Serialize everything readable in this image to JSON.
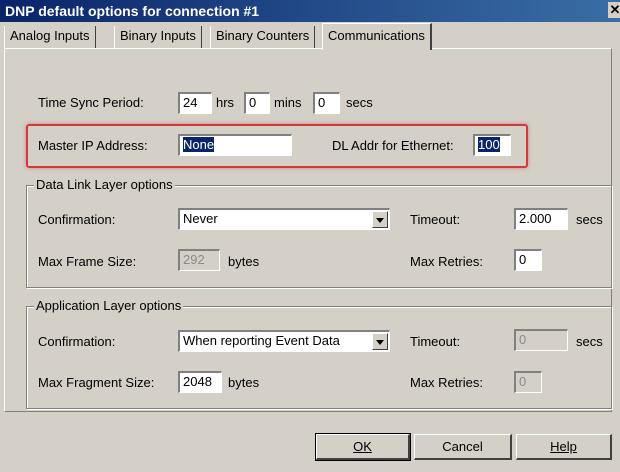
{
  "window": {
    "title": "DNP default options for connection #1",
    "close_glyph": "✕"
  },
  "tabs": [
    {
      "label": "Analog Inputs"
    },
    {
      "label": "Binary Inputs"
    },
    {
      "label": "Binary Counters"
    },
    {
      "label": "Communications",
      "active": true
    }
  ],
  "time_sync": {
    "label": "Time Sync Period:",
    "hrs_value": "24",
    "hrs_unit": "hrs",
    "mins_value": "0",
    "mins_unit": "mins",
    "secs_value": "0",
    "secs_unit": "secs"
  },
  "master": {
    "ip_label": "Master IP Address:",
    "ip_value": "None",
    "dl_label": "DL Addr for Ethernet:",
    "dl_value": "100"
  },
  "data_link": {
    "legend": "Data Link Layer options",
    "confirmation_label": "Confirmation:",
    "confirmation_value": "Never",
    "timeout_label": "Timeout:",
    "timeout_value": "2.000",
    "timeout_unit": "secs",
    "frame_label": "Max Frame Size:",
    "frame_value": "292",
    "frame_unit": "bytes",
    "retries_label": "Max Retries:",
    "retries_value": "0"
  },
  "application": {
    "legend": "Application Layer options",
    "confirmation_label": "Confirmation:",
    "confirmation_value": "When reporting Event Data",
    "timeout_label": "Timeout:",
    "timeout_value": "0",
    "timeout_unit": "secs",
    "fragment_label": "Max Fragment Size:",
    "fragment_value": "2048",
    "fragment_unit": "bytes",
    "retries_label": "Max Retries:",
    "retries_value": "0"
  },
  "buttons": {
    "ok": "OK",
    "cancel": "Cancel",
    "help": "Help"
  },
  "colors": {
    "titlebar": "#0a246a",
    "face": "#d4d0c8",
    "highlight": "#d23a3a"
  }
}
